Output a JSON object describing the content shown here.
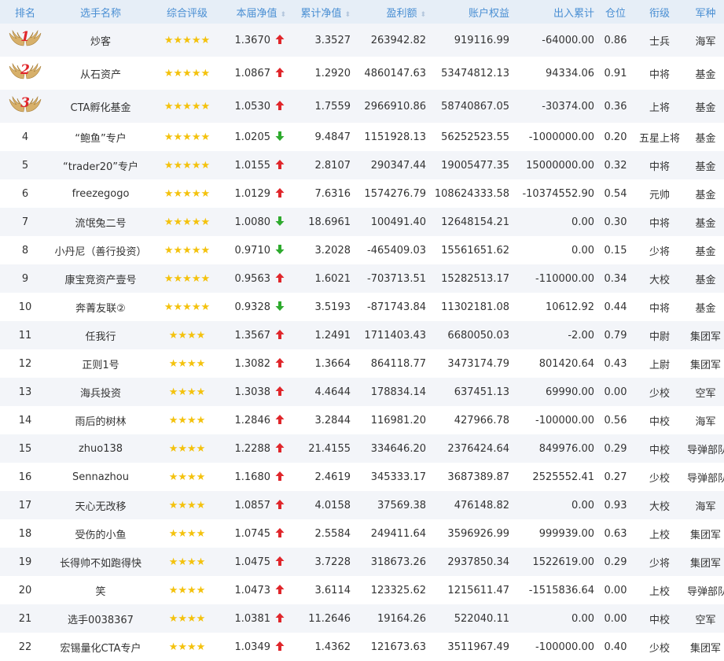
{
  "table": {
    "headers": {
      "rank": "排名",
      "name": "选手名称",
      "rating": "综合评级",
      "current_nav": "本届净值",
      "cumulative_nav": "累计净值",
      "profit": "盈利额",
      "equity": "账户权益",
      "in_out": "出入累计",
      "position": "仓位",
      "title": "衔级",
      "branch": "军种"
    },
    "colors": {
      "up": "#e0262b",
      "down": "#2eaa2e",
      "star": "#f4c20d",
      "header_text": "#4a8fd3"
    },
    "rows": [
      {
        "rank": "1",
        "name": "炒客",
        "stars": "★★★★★",
        "nav": "1.3670",
        "dir": "up",
        "cum": "3.3527",
        "profit": "263942.82",
        "equity": "919116.99",
        "inout": "-64000.00",
        "pos": "0.86",
        "title": "士兵",
        "branch": "海军"
      },
      {
        "rank": "2",
        "name": "从石资产",
        "stars": "★★★★★",
        "nav": "1.0867",
        "dir": "up",
        "cum": "1.2920",
        "profit": "4860147.63",
        "equity": "53474812.13",
        "inout": "94334.06",
        "pos": "0.91",
        "title": "中将",
        "branch": "基金"
      },
      {
        "rank": "3",
        "name": "CTA孵化基金",
        "stars": "★★★★★",
        "nav": "1.0530",
        "dir": "up",
        "cum": "1.7559",
        "profit": "2966910.86",
        "equity": "58740867.05",
        "inout": "-30374.00",
        "pos": "0.36",
        "title": "上将",
        "branch": "基金"
      },
      {
        "rank": "4",
        "name": "“鲍鱼”专户",
        "stars": "★★★★★",
        "nav": "1.0205",
        "dir": "down",
        "cum": "9.4847",
        "profit": "1151928.13",
        "equity": "56252523.55",
        "inout": "-1000000.00",
        "pos": "0.20",
        "title": "五星上将",
        "branch": "基金"
      },
      {
        "rank": "5",
        "name": "“trader20”专户",
        "stars": "★★★★★",
        "nav": "1.0155",
        "dir": "up",
        "cum": "2.8107",
        "profit": "290347.44",
        "equity": "19005477.35",
        "inout": "15000000.00",
        "pos": "0.32",
        "title": "中将",
        "branch": "基金"
      },
      {
        "rank": "6",
        "name": "freezegogo",
        "stars": "★★★★★",
        "nav": "1.0129",
        "dir": "up",
        "cum": "7.6316",
        "profit": "1574276.79",
        "equity": "108624333.58",
        "inout": "-10374552.90",
        "pos": "0.54",
        "title": "元帅",
        "branch": "基金"
      },
      {
        "rank": "7",
        "name": "流氓兔二号",
        "stars": "★★★★★",
        "nav": "1.0080",
        "dir": "down",
        "cum": "18.6961",
        "profit": "100491.40",
        "equity": "12648154.21",
        "inout": "0.00",
        "pos": "0.30",
        "title": "中将",
        "branch": "基金"
      },
      {
        "rank": "8",
        "name": "小丹尼（善行投资）",
        "stars": "★★★★★",
        "nav": "0.9710",
        "dir": "down",
        "cum": "3.2028",
        "profit": "-465409.03",
        "equity": "15561651.62",
        "inout": "0.00",
        "pos": "0.15",
        "title": "少将",
        "branch": "基金"
      },
      {
        "rank": "9",
        "name": "康宝竞资产壹号",
        "stars": "★★★★★",
        "nav": "0.9563",
        "dir": "up",
        "cum": "1.6021",
        "profit": "-703713.51",
        "equity": "15282513.17",
        "inout": "-110000.00",
        "pos": "0.34",
        "title": "大校",
        "branch": "基金"
      },
      {
        "rank": "10",
        "name": "奔菁友联②",
        "stars": "★★★★★",
        "nav": "0.9328",
        "dir": "down",
        "cum": "3.5193",
        "profit": "-871743.84",
        "equity": "11302181.08",
        "inout": "10612.92",
        "pos": "0.44",
        "title": "中将",
        "branch": "基金"
      },
      {
        "rank": "11",
        "name": "任我行",
        "stars": "★★★★",
        "nav": "1.3567",
        "dir": "up",
        "cum": "1.2491",
        "profit": "1711403.43",
        "equity": "6680050.03",
        "inout": "-2.00",
        "pos": "0.79",
        "title": "中尉",
        "branch": "集团军"
      },
      {
        "rank": "12",
        "name": "正则1号",
        "stars": "★★★★",
        "nav": "1.3082",
        "dir": "up",
        "cum": "1.3664",
        "profit": "864118.77",
        "equity": "3473174.79",
        "inout": "801420.64",
        "pos": "0.43",
        "title": "上尉",
        "branch": "集团军"
      },
      {
        "rank": "13",
        "name": "海兵投资",
        "stars": "★★★★",
        "nav": "1.3038",
        "dir": "up",
        "cum": "4.4644",
        "profit": "178834.14",
        "equity": "637451.13",
        "inout": "69990.00",
        "pos": "0.00",
        "title": "少校",
        "branch": "空军"
      },
      {
        "rank": "14",
        "name": "雨后的树林",
        "stars": "★★★★",
        "nav": "1.2846",
        "dir": "up",
        "cum": "3.2844",
        "profit": "116981.20",
        "equity": "427966.78",
        "inout": "-100000.00",
        "pos": "0.56",
        "title": "中校",
        "branch": "海军"
      },
      {
        "rank": "15",
        "name": "zhuo138",
        "stars": "★★★★",
        "nav": "1.2288",
        "dir": "up",
        "cum": "21.4155",
        "profit": "334646.20",
        "equity": "2376424.64",
        "inout": "849976.00",
        "pos": "0.29",
        "title": "中校",
        "branch": "导弹部队"
      },
      {
        "rank": "16",
        "name": "Sennazhou",
        "stars": "★★★★",
        "nav": "1.1680",
        "dir": "up",
        "cum": "2.4619",
        "profit": "345333.17",
        "equity": "3687389.87",
        "inout": "2525552.41",
        "pos": "0.27",
        "title": "少校",
        "branch": "导弹部队"
      },
      {
        "rank": "17",
        "name": "天心无改移",
        "stars": "★★★★",
        "nav": "1.0857",
        "dir": "up",
        "cum": "4.0158",
        "profit": "37569.38",
        "equity": "476148.82",
        "inout": "0.00",
        "pos": "0.93",
        "title": "大校",
        "branch": "海军"
      },
      {
        "rank": "18",
        "name": "受伤的小鱼",
        "stars": "★★★★",
        "nav": "1.0745",
        "dir": "up",
        "cum": "2.5584",
        "profit": "249411.64",
        "equity": "3596926.99",
        "inout": "999939.00",
        "pos": "0.63",
        "title": "上校",
        "branch": "集团军"
      },
      {
        "rank": "19",
        "name": "长得帅不如跑得快",
        "stars": "★★★★",
        "nav": "1.0475",
        "dir": "up",
        "cum": "3.7228",
        "profit": "318673.26",
        "equity": "2937850.34",
        "inout": "1522619.00",
        "pos": "0.29",
        "title": "少将",
        "branch": "集团军"
      },
      {
        "rank": "20",
        "name": "笑",
        "stars": "★★★★",
        "nav": "1.0473",
        "dir": "up",
        "cum": "3.6114",
        "profit": "123325.62",
        "equity": "1215611.47",
        "inout": "-1515836.64",
        "pos": "0.00",
        "title": "上校",
        "branch": "导弹部队"
      },
      {
        "rank": "21",
        "name": "选手0038367",
        "stars": "★★★★",
        "nav": "1.0381",
        "dir": "up",
        "cum": "11.2646",
        "profit": "19164.26",
        "equity": "522040.11",
        "inout": "0.00",
        "pos": "0.00",
        "title": "中校",
        "branch": "空军"
      },
      {
        "rank": "22",
        "name": "宏锡量化CTA专户",
        "stars": "★★★★",
        "nav": "1.0349",
        "dir": "up",
        "cum": "1.4362",
        "profit": "121673.63",
        "equity": "3511967.49",
        "inout": "-100000.00",
        "pos": "0.40",
        "title": "少校",
        "branch": "集团军"
      }
    ]
  }
}
